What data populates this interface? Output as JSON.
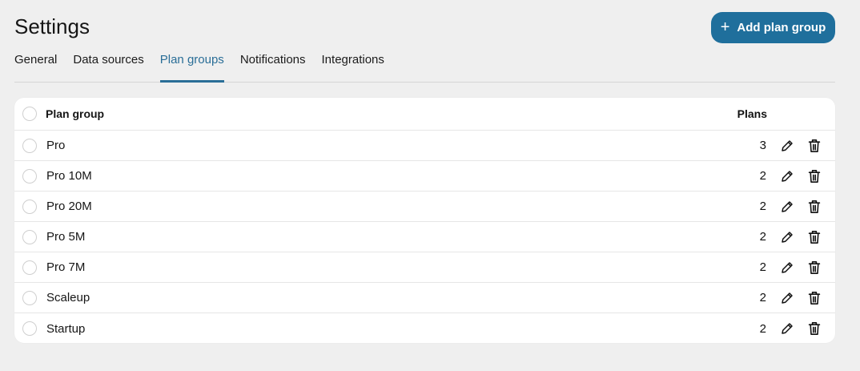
{
  "page": {
    "title": "Settings",
    "add_button_label": "Add plan group"
  },
  "tabs": [
    {
      "label": "General",
      "active": false
    },
    {
      "label": "Data sources",
      "active": false
    },
    {
      "label": "Plan groups",
      "active": true
    },
    {
      "label": "Notifications",
      "active": false
    },
    {
      "label": "Integrations",
      "active": false
    }
  ],
  "table": {
    "columns": {
      "name": "Plan group",
      "plans": "Plans"
    },
    "rows": [
      {
        "name": "Pro",
        "plans": "3"
      },
      {
        "name": "Pro 10M",
        "plans": "2"
      },
      {
        "name": "Pro 20M",
        "plans": "2"
      },
      {
        "name": "Pro 5M",
        "plans": "2"
      },
      {
        "name": "Pro 7M",
        "plans": "2"
      },
      {
        "name": "Scaleup",
        "plans": "2"
      },
      {
        "name": "Startup",
        "plans": "2"
      }
    ]
  },
  "icons": {
    "add": "plus-icon",
    "edit": "pencil-icon",
    "delete": "trash-icon"
  },
  "colors": {
    "accent": "#1f6f9c",
    "active_tab": "#2a6e97",
    "background": "#efefef"
  }
}
